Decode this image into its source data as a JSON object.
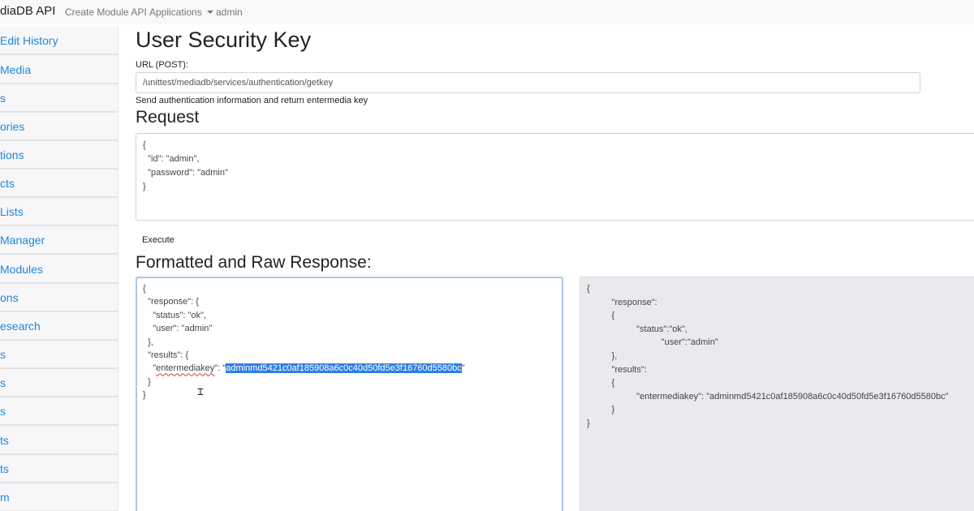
{
  "navbar": {
    "brand": "diaDB API",
    "links": [
      {
        "label": "Create Module API"
      },
      {
        "label": "Applications"
      },
      {
        "label": "admin"
      }
    ]
  },
  "sidebar": {
    "items": [
      {
        "label": "Edit History"
      },
      {
        "label": "Media"
      },
      {
        "label": "s"
      },
      {
        "label": "ories"
      },
      {
        "label": "tions"
      },
      {
        "label": "cts"
      },
      {
        "label": "Lists"
      },
      {
        "label": "Manager"
      },
      {
        "label": "Modules"
      },
      {
        "label": "ons"
      },
      {
        "label": "esearch"
      },
      {
        "label": "s"
      },
      {
        "label": "s"
      },
      {
        "label": "s"
      },
      {
        "label": "ts"
      },
      {
        "label": "ts"
      },
      {
        "label": "m"
      }
    ]
  },
  "main": {
    "title": "User Security Key",
    "url_label": "URL (POST):",
    "url_value": "/unittest/mediadb/services/authentication/getkey",
    "description": "Send authentication information and return entermedia key",
    "request_heading": "Request",
    "request_body": "{\n  \"id\": \"admin\",\n  \"password\": \"admin\"\n}",
    "execute_label": "Execute",
    "response_heading": "Formatted and Raw Response:",
    "formatted": {
      "lines_before": [
        "{",
        "  \"response\": {",
        "    \"status\": \"ok\",",
        "    \"user\": \"admin\"",
        "  },",
        "  \"results\": {"
      ],
      "key_indent": "    \"",
      "key_name": "entermediakey",
      "key_sep": "\": \"",
      "key_value": "adminmd5421c0af185908a6c0c40d50fd5e3f16760d5580bc",
      "key_end": "\"",
      "lines_after": [
        "  }",
        "}"
      ]
    },
    "raw_lines": [
      "{",
      "          \"response\":",
      "          {",
      "                    \"status\":\"ok\",",
      "                              \"user\":\"admin\"",
      "          },",
      "          \"results\":",
      "          {",
      "                    \"entermediakey\": \"adminmd5421c0af185908a6c0c40d50fd5e3f16760d5580bc\"",
      "          }",
      "}"
    ]
  }
}
